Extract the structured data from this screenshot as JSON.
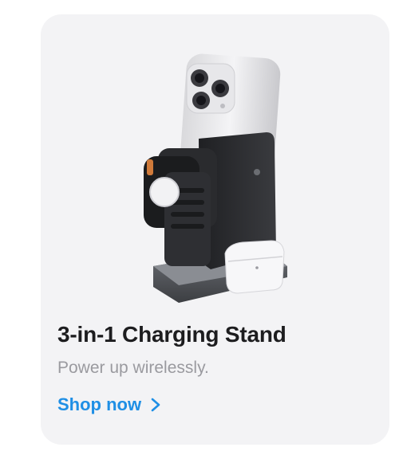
{
  "card": {
    "title": "3-in-1 Charging Stand",
    "subtitle": "Power up wirelessly.",
    "link_label": "Shop now",
    "link_icon": "chevron-right-icon",
    "product_image_alt": "3-in-1 charging stand with phone, watch and earbuds"
  },
  "colors": {
    "card_background": "#f3f3f5",
    "title": "#1d1d1f",
    "subtitle": "#9a9a9f",
    "link": "#1f8fe5"
  }
}
